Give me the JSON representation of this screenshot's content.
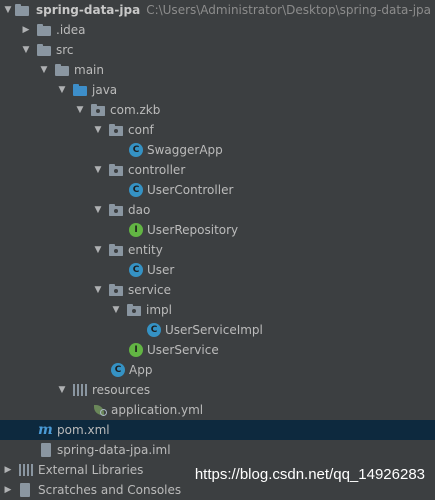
{
  "project": {
    "name": "spring-data-jpa",
    "path": "C:\\Users\\Administrator\\Desktop\\spring-data-jpa"
  },
  "tree": {
    "idea": ".idea",
    "src": "src",
    "main": "main",
    "java": "java",
    "pkg_root": "com.zkb",
    "conf": "conf",
    "swagger_app": "SwaggerApp",
    "controller": "controller",
    "user_controller": "UserController",
    "dao": "dao",
    "user_repository": "UserRepository",
    "entity": "entity",
    "user": "User",
    "service": "service",
    "impl": "impl",
    "user_service_impl": "UserServiceImpl",
    "user_service": "UserService",
    "app": "App",
    "resources": "resources",
    "application_yml": "application.yml",
    "pom": "pom.xml",
    "iml": "spring-data-jpa.iml",
    "external_libraries": "External Libraries",
    "scratches": "Scratches and Consoles"
  },
  "watermark": "https://blog.csdn.net/qq_14926283",
  "colors": {
    "background": "#3c3f41",
    "selection": "#0d293e",
    "class_icon": "#3592c4",
    "interface_icon": "#62b543",
    "source_folder": "#3d8ec9"
  }
}
